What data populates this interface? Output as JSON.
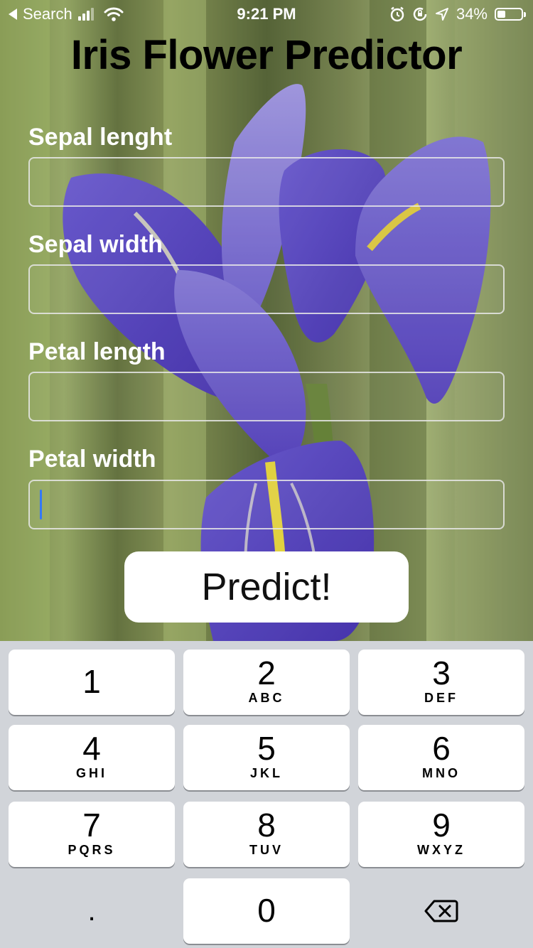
{
  "status_bar": {
    "back_label": "Search",
    "time": "9:21 PM",
    "battery_percent": "34%",
    "battery_level": 0.34,
    "icons": [
      "back-arrow-icon",
      "signal-icon",
      "wifi-icon",
      "alarm-icon",
      "orientation-lock-icon",
      "location-icon",
      "battery-icon"
    ]
  },
  "app": {
    "title": "Iris Flower Predictor",
    "fields": [
      {
        "label": "Sepal lenght",
        "value": ""
      },
      {
        "label": "Sepal width",
        "value": ""
      },
      {
        "label": "Petal length",
        "value": ""
      },
      {
        "label": "Petal width",
        "value": ""
      }
    ],
    "predict_label": "Predict!",
    "background_image": "iris-flower-photo"
  },
  "keyboard": {
    "keys": [
      {
        "num": "1",
        "letters": ""
      },
      {
        "num": "2",
        "letters": "ABC"
      },
      {
        "num": "3",
        "letters": "DEF"
      },
      {
        "num": "4",
        "letters": "GHI"
      },
      {
        "num": "5",
        "letters": "JKL"
      },
      {
        "num": "6",
        "letters": "MNO"
      },
      {
        "num": "7",
        "letters": "PQRS"
      },
      {
        "num": "8",
        "letters": "TUV"
      },
      {
        "num": "9",
        "letters": "WXYZ"
      },
      {
        "num": "0",
        "letters": ""
      }
    ],
    "decimal_label": ".",
    "delete_icon": "delete-backspace-icon"
  }
}
